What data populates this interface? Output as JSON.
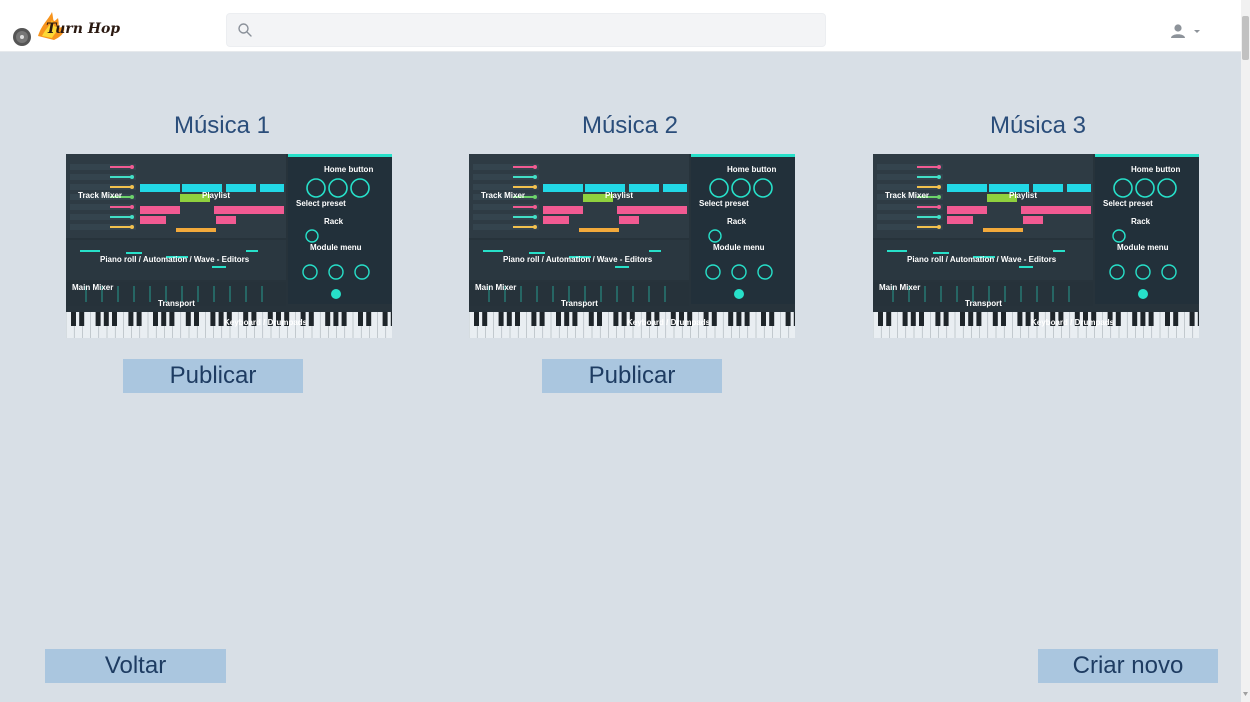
{
  "header": {
    "logo_text": "Turn Hop",
    "search": {
      "placeholder": "",
      "value": ""
    },
    "icons": {
      "search": "search-icon",
      "user": "user-icon",
      "dropdown": "caret-down-icon"
    }
  },
  "colors": {
    "background": "#d8dfe6",
    "button": "#aac6df",
    "title_text": "#2a4d7a",
    "button_text": "#1e3c62"
  },
  "tracks": [
    {
      "title": "Música 1",
      "publish_label": "Publicar",
      "publishable": true
    },
    {
      "title": "Música 2",
      "publish_label": "Publicar",
      "publishable": true
    },
    {
      "title": "Música 3",
      "publishable": false
    }
  ],
  "thumbnail_labels": {
    "track_mixer": "Track Mixer",
    "playlist": "Playlist",
    "home_button": "Home button",
    "select_preset": "Select preset",
    "rack": "Rack",
    "module_menu": "Module menu",
    "piano_roll": "Piano roll / Automation / Wave - Editors",
    "main_mixer": "Main Mixer",
    "transport": "Transport",
    "keyboard": "Keyboard / Drumpads"
  },
  "footer": {
    "back_label": "Voltar",
    "create_label": "Criar novo"
  }
}
